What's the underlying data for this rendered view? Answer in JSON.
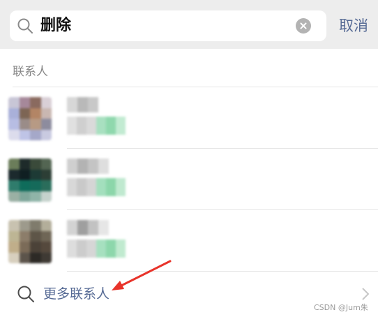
{
  "search": {
    "query": "删除",
    "cancel_label": "取消"
  },
  "results": {
    "section_title": "联系人",
    "more_label": "更多联系人",
    "contacts": [
      {
        "avatar_colors": [
          "#c8c6d6",
          "#a6889a",
          "#8a6a5f",
          "#d9cfd6",
          "#a9b0d9",
          "#7d6554",
          "#b38565",
          "#c9b7b1",
          "#b7bde3",
          "#9a8c88",
          "#b79a84",
          "#8d8c9e",
          "#dcdcec",
          "#bfc4e6",
          "#a5a8c9",
          "#c9cae0"
        ],
        "name_pixels": [
          "#d7d7d7",
          "#b9b9b9",
          "#c8c8c8",
          "#ffffff"
        ],
        "line_pixels": [
          "#e0e0e0",
          "#cfcfcf",
          "#dadada",
          "#a8e0c0",
          "#8fd8ad",
          "#c2ebd2",
          "#ffffff"
        ]
      },
      {
        "avatar_colors": [
          "#6b7d5a",
          "#1e2b2a",
          "#3a4a3a",
          "#536552",
          "#1c2a2d",
          "#0f1f22",
          "#1d3a35",
          "#2c3e35",
          "#2f7c6c",
          "#0f6c5b",
          "#156a5a",
          "#2a6d5b",
          "#9ab0a4",
          "#7fa69a",
          "#8fb4a8",
          "#c5d2cc"
        ],
        "name_pixels": [
          "#cfcfcf",
          "#b3b3b3",
          "#c4c4c4",
          "#dedede"
        ],
        "line_pixels": [
          "#d8d8d8",
          "#c9c9c9",
          "#d5d5d5",
          "#a3dfbd",
          "#8cd6aa",
          "#bfe9cf",
          "#ffffff"
        ]
      },
      {
        "avatar_colors": [
          "#c8c2b0",
          "#9d9a8c",
          "#7f7b6c",
          "#b3ae9a",
          "#bdb594",
          "#8c7d6a",
          "#5e5548",
          "#6f6656",
          "#c0ae8a",
          "#7b6b58",
          "#4b4238",
          "#55493d",
          "#d7cfbe",
          "#5c544b",
          "#2d2a26",
          "#3f3a34"
        ],
        "name_pixels": [
          "#d3d3d3",
          "#9f9f9f",
          "#c2c2c2",
          "#e6e6e6"
        ],
        "line_pixels": [
          "#dddddd",
          "#cccccc",
          "#d6d6d6",
          "#a6e0bf",
          "#8dd7ab",
          "#c0eacf",
          "#ffffff"
        ]
      }
    ]
  },
  "watermark": "CSDN @Jum朱",
  "icons": {
    "search": "search-icon",
    "clear": "clear-icon",
    "more_search": "search-icon",
    "chevron": "chevron-right-icon",
    "annotation": "red-arrow-icon"
  },
  "colors": {
    "link_blue": "#576b95",
    "annotation_red": "#e8332a"
  }
}
